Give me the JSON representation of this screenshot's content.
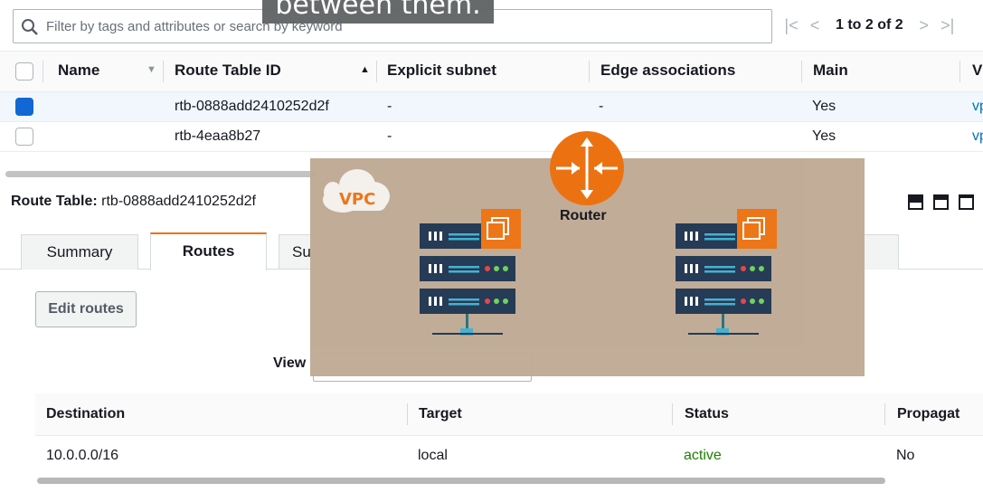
{
  "caption": {
    "text": "between them."
  },
  "filter": {
    "placeholder": "Filter by tags and attributes or search by keyword"
  },
  "pager": {
    "text": "1 to 2 of 2"
  },
  "table": {
    "columns": [
      "Name",
      "Route Table ID",
      "Explicit subnet association",
      "Edge associations",
      "Main",
      "V"
    ],
    "rows": [
      {
        "name": "",
        "id": "rtb-0888add2410252d2f",
        "explicit": "-",
        "edge": "-",
        "main": "Yes",
        "vpc": "vp",
        "selected": true
      },
      {
        "name": "",
        "id": "rtb-4eaa8b27",
        "explicit": "-",
        "edge": "",
        "main": "Yes",
        "vpc": "vp",
        "selected": false
      }
    ]
  },
  "detail": {
    "title_label": "Route Table:",
    "title_value": "rtb-0888add2410252d2f",
    "tabs": [
      "Summary",
      "Routes",
      "Su"
    ],
    "edit_button": "Edit routes",
    "view_label": "View"
  },
  "routes": {
    "columns": [
      "Destination",
      "Target",
      "Status",
      "Propagat"
    ],
    "rows": [
      {
        "destination": "10.0.0.0/16",
        "target": "local",
        "status": "active",
        "propagated": "No"
      }
    ]
  },
  "overlay": {
    "vpc_label": "VPC",
    "router_label": "Router",
    "colors": {
      "background": "#c0aa95",
      "accent": "#ec7211",
      "server": "#1f3550",
      "cloud": "#f4f0ec"
    }
  }
}
